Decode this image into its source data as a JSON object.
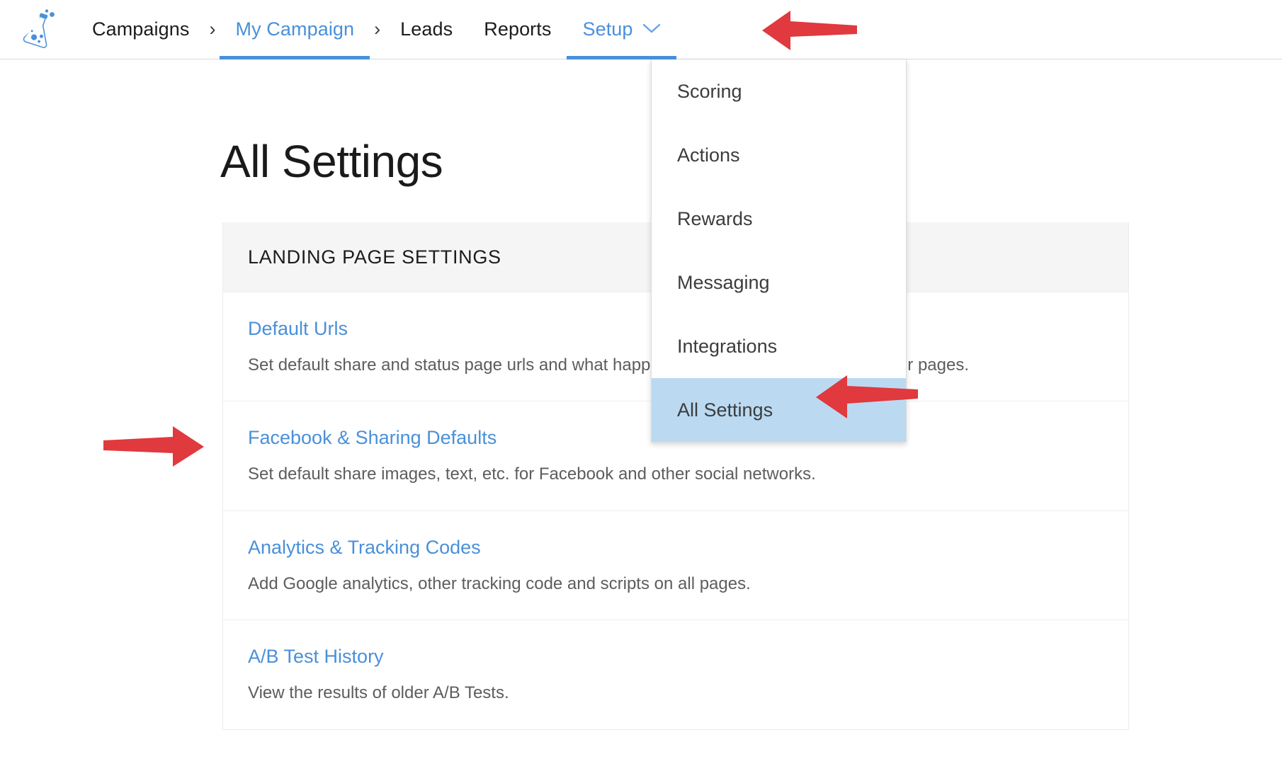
{
  "brand": {
    "logo_icon": "flask-icon"
  },
  "nav": {
    "items": [
      {
        "label": "Campaigns",
        "style": "plain",
        "state": "normal"
      },
      {
        "label": "My Campaign",
        "style": "link",
        "state": "active"
      },
      {
        "label": "Leads",
        "style": "plain",
        "state": "normal"
      },
      {
        "label": "Reports",
        "style": "plain",
        "state": "normal"
      },
      {
        "label": "Setup",
        "style": "link",
        "state": "open",
        "caret": "chevron-down-icon"
      }
    ],
    "separator": "›"
  },
  "dropdown": {
    "items": [
      {
        "label": "Scoring",
        "selected": false
      },
      {
        "label": "Actions",
        "selected": false
      },
      {
        "label": "Rewards",
        "selected": false
      },
      {
        "label": "Messaging",
        "selected": false
      },
      {
        "label": "Integrations",
        "selected": false
      },
      {
        "label": "All Settings",
        "selected": true
      }
    ],
    "selected_bg": "#bbdaf2"
  },
  "main": {
    "page_title": "All Settings",
    "card": {
      "section_header": "LANDING PAGE SETTINGS",
      "rows": [
        {
          "title": "Default Urls",
          "desc": "Set default share and status page urls and what happens when unknown leads visit your pages."
        },
        {
          "title": "Facebook & Sharing Defaults",
          "desc": "Set default share images, text, etc. for Facebook and other social networks."
        },
        {
          "title": "Analytics & Tracking Codes",
          "desc": "Add Google analytics, other tracking code and scripts on all pages."
        },
        {
          "title": "A/B Test History",
          "desc": "View the results of older A/B Tests."
        }
      ]
    }
  },
  "annotations": {
    "color": "#e0393e",
    "arrows": [
      {
        "name": "arrow-pointing-to-setup-tab",
        "direction": "left"
      },
      {
        "name": "arrow-pointing-to-all-settings-item",
        "direction": "left"
      },
      {
        "name": "arrow-pointing-to-facebook-sharing",
        "direction": "right"
      }
    ]
  },
  "colors": {
    "accent_blue": "#4a90d9",
    "header_band": "#f5f5f5",
    "text_dark": "#1c1c1c",
    "text_muted": "#5d5d5d"
  }
}
